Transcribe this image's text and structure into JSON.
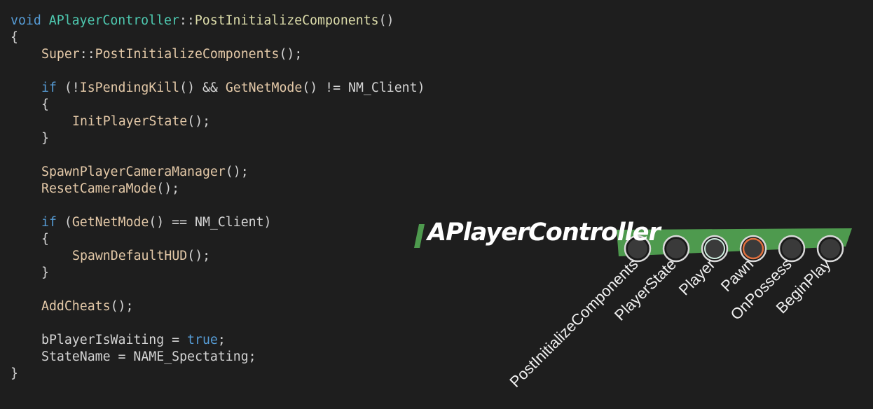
{
  "code": {
    "lines": [
      {
        "indent": 0,
        "tokens": [
          {
            "t": "void ",
            "k": "kw"
          },
          {
            "t": "APlayerController",
            "k": "cls"
          },
          {
            "t": "::",
            "k": "plain"
          },
          {
            "t": "PostInitializeComponents",
            "k": "fn"
          },
          {
            "t": "()",
            "k": "plain"
          }
        ]
      },
      {
        "indent": 0,
        "tokens": [
          {
            "t": "{",
            "k": "plain"
          }
        ]
      },
      {
        "indent": 1,
        "tokens": [
          {
            "t": "Super",
            "k": "fnl"
          },
          {
            "t": "::",
            "k": "plain"
          },
          {
            "t": "PostInitializeComponents",
            "k": "fnl"
          },
          {
            "t": "();",
            "k": "plain"
          }
        ]
      },
      {
        "indent": 0,
        "tokens": []
      },
      {
        "indent": 1,
        "tokens": [
          {
            "t": "if",
            "k": "kw"
          },
          {
            "t": " (!",
            "k": "plain"
          },
          {
            "t": "IsPendingKill",
            "k": "fnl"
          },
          {
            "t": "() && ",
            "k": "plain"
          },
          {
            "t": "GetNetMode",
            "k": "fnl"
          },
          {
            "t": "() != NM_Client)",
            "k": "plain"
          }
        ]
      },
      {
        "indent": 1,
        "tokens": [
          {
            "t": "{",
            "k": "plain"
          }
        ]
      },
      {
        "indent": 2,
        "tokens": [
          {
            "t": "InitPlayerState",
            "k": "fnl"
          },
          {
            "t": "();",
            "k": "plain"
          }
        ]
      },
      {
        "indent": 1,
        "tokens": [
          {
            "t": "}",
            "k": "plain"
          }
        ]
      },
      {
        "indent": 0,
        "tokens": []
      },
      {
        "indent": 1,
        "tokens": [
          {
            "t": "SpawnPlayerCameraManager",
            "k": "fnl"
          },
          {
            "t": "();",
            "k": "plain"
          }
        ]
      },
      {
        "indent": 1,
        "tokens": [
          {
            "t": "ResetCameraMode",
            "k": "fnl"
          },
          {
            "t": "();",
            "k": "plain"
          }
        ]
      },
      {
        "indent": 0,
        "tokens": []
      },
      {
        "indent": 1,
        "tokens": [
          {
            "t": "if",
            "k": "kw"
          },
          {
            "t": " (",
            "k": "plain"
          },
          {
            "t": "GetNetMode",
            "k": "fnl"
          },
          {
            "t": "() == NM_Client)",
            "k": "plain"
          }
        ]
      },
      {
        "indent": 1,
        "tokens": [
          {
            "t": "{",
            "k": "plain"
          }
        ]
      },
      {
        "indent": 2,
        "tokens": [
          {
            "t": "SpawnDefaultHUD",
            "k": "fnl"
          },
          {
            "t": "();",
            "k": "plain"
          }
        ]
      },
      {
        "indent": 1,
        "tokens": [
          {
            "t": "}",
            "k": "plain"
          }
        ]
      },
      {
        "indent": 0,
        "tokens": []
      },
      {
        "indent": 1,
        "tokens": [
          {
            "t": "AddCheats",
            "k": "fnl"
          },
          {
            "t": "();",
            "k": "plain"
          }
        ]
      },
      {
        "indent": 0,
        "tokens": []
      },
      {
        "indent": 1,
        "tokens": [
          {
            "t": "bPlayerIsWaiting = ",
            "k": "plain"
          },
          {
            "t": "true",
            "k": "kw"
          },
          {
            "t": ";",
            "k": "plain"
          }
        ]
      },
      {
        "indent": 1,
        "tokens": [
          {
            "t": "StateName = NAME_Spectating;",
            "k": "plain"
          }
        ]
      },
      {
        "indent": 0,
        "tokens": [
          {
            "t": "}",
            "k": "plain"
          }
        ]
      }
    ]
  },
  "overlay": {
    "title": "APlayerController",
    "accent_color": "#4e9a4e",
    "stages": [
      {
        "label": "PostInitializeComponents",
        "state": "inactive"
      },
      {
        "label": "PlayerState",
        "state": "inactive"
      },
      {
        "label": "Player",
        "state": "highlighted"
      },
      {
        "label": "Pawn",
        "state": "active"
      },
      {
        "label": "OnPossess",
        "state": "inactive"
      },
      {
        "label": "BeginPlay",
        "state": "inactive"
      }
    ],
    "colors": {
      "inactive": "#3a3a3a",
      "highlighted": "#cfeee0",
      "active": "#e0703e"
    }
  }
}
